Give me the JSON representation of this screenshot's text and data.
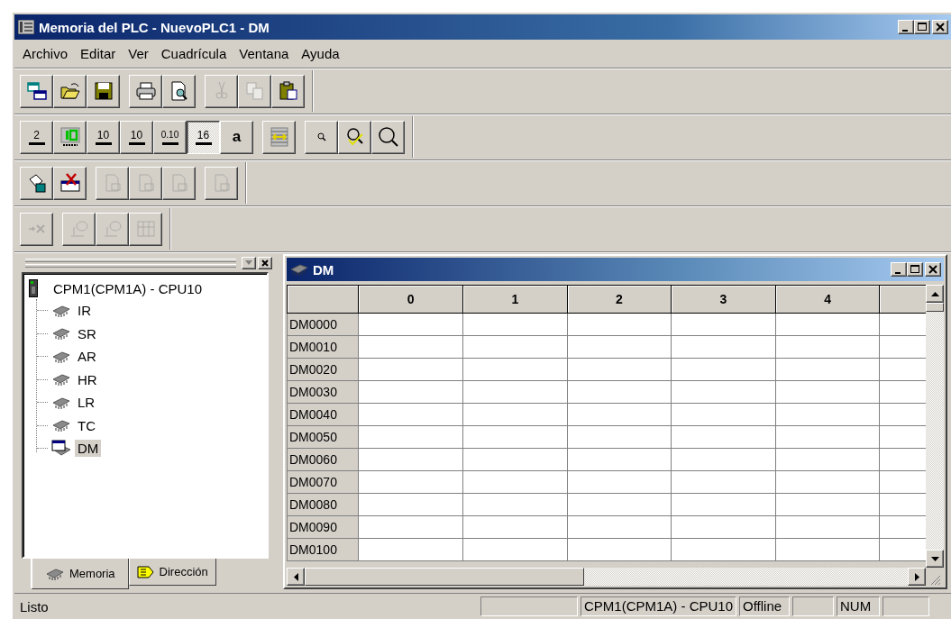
{
  "window": {
    "title": "Memoria del PLC - NuevoPLC1 - DM"
  },
  "menu": [
    {
      "label": "Archivo"
    },
    {
      "label": "Editar"
    },
    {
      "label": "Ver"
    },
    {
      "label": "Cuadrícula"
    },
    {
      "label": "Ventana"
    },
    {
      "label": "Ayuda"
    }
  ],
  "toolbars": [
    {
      "groups": [
        [
          {
            "disabled": false
          },
          {
            "disabled": false
          },
          {
            "disabled": false
          }
        ],
        [
          {
            "disabled": false
          },
          {
            "disabled": false
          }
        ],
        [
          {
            "disabled": true
          },
          {
            "disabled": true
          },
          {
            "disabled": false
          }
        ]
      ]
    },
    {
      "groups": [
        [
          {
            "label": "2",
            "disabled": false,
            "selected": false
          },
          {
            "disabled": false,
            "selected": false
          },
          {
            "label": "10",
            "disabled": false,
            "selected": false
          },
          {
            "label": "10",
            "disabled": false,
            "selected": false
          },
          {
            "label": "0.10",
            "disabled": false,
            "selected": false
          },
          {
            "label": "16",
            "disabled": false,
            "selected": true
          },
          {
            "label": "a",
            "disabled": false,
            "selected": false
          }
        ],
        [
          {
            "disabled": false
          }
        ],
        [
          {
            "disabled": false
          },
          {
            "disabled": false
          },
          {
            "disabled": false
          }
        ]
      ]
    },
    {
      "groups": [
        [
          {
            "disabled": false
          },
          {
            "disabled": false
          }
        ],
        [
          {
            "disabled": true
          },
          {
            "disabled": true
          },
          {
            "disabled": true
          }
        ],
        [
          {
            "disabled": true
          }
        ]
      ]
    },
    {
      "groups": [
        [
          {
            "disabled": true
          }
        ],
        [
          {
            "disabled": true
          },
          {
            "disabled": true
          },
          {
            "disabled": true
          }
        ]
      ]
    }
  ],
  "tree": {
    "label": "CPM1(CPM1A) - CPU10",
    "children": [
      {
        "label": "IR",
        "selected": false
      },
      {
        "label": "SR",
        "selected": false
      },
      {
        "label": "AR",
        "selected": false
      },
      {
        "label": "HR",
        "selected": false
      },
      {
        "label": "LR",
        "selected": false
      },
      {
        "label": "TC",
        "selected": false
      },
      {
        "label": "DM",
        "selected": true
      }
    ]
  },
  "pane_tabs": [
    {
      "label": "Memoria",
      "selected": true
    },
    {
      "label": "Dirección",
      "selected": false
    }
  ],
  "child_window": {
    "title": "DM"
  },
  "table": {
    "columns": [
      "0",
      "1",
      "2",
      "3",
      "4"
    ],
    "rows": [
      "DM0000",
      "DM0010",
      "DM0020",
      "DM0030",
      "DM0040",
      "DM0050",
      "DM0060",
      "DM0070",
      "DM0080",
      "DM0090",
      "DM0100"
    ]
  },
  "status_bar": {
    "message": "Listo",
    "panels": [
      "CPM1(CPM1A) - CPU10",
      "Offline",
      "NUM"
    ]
  }
}
